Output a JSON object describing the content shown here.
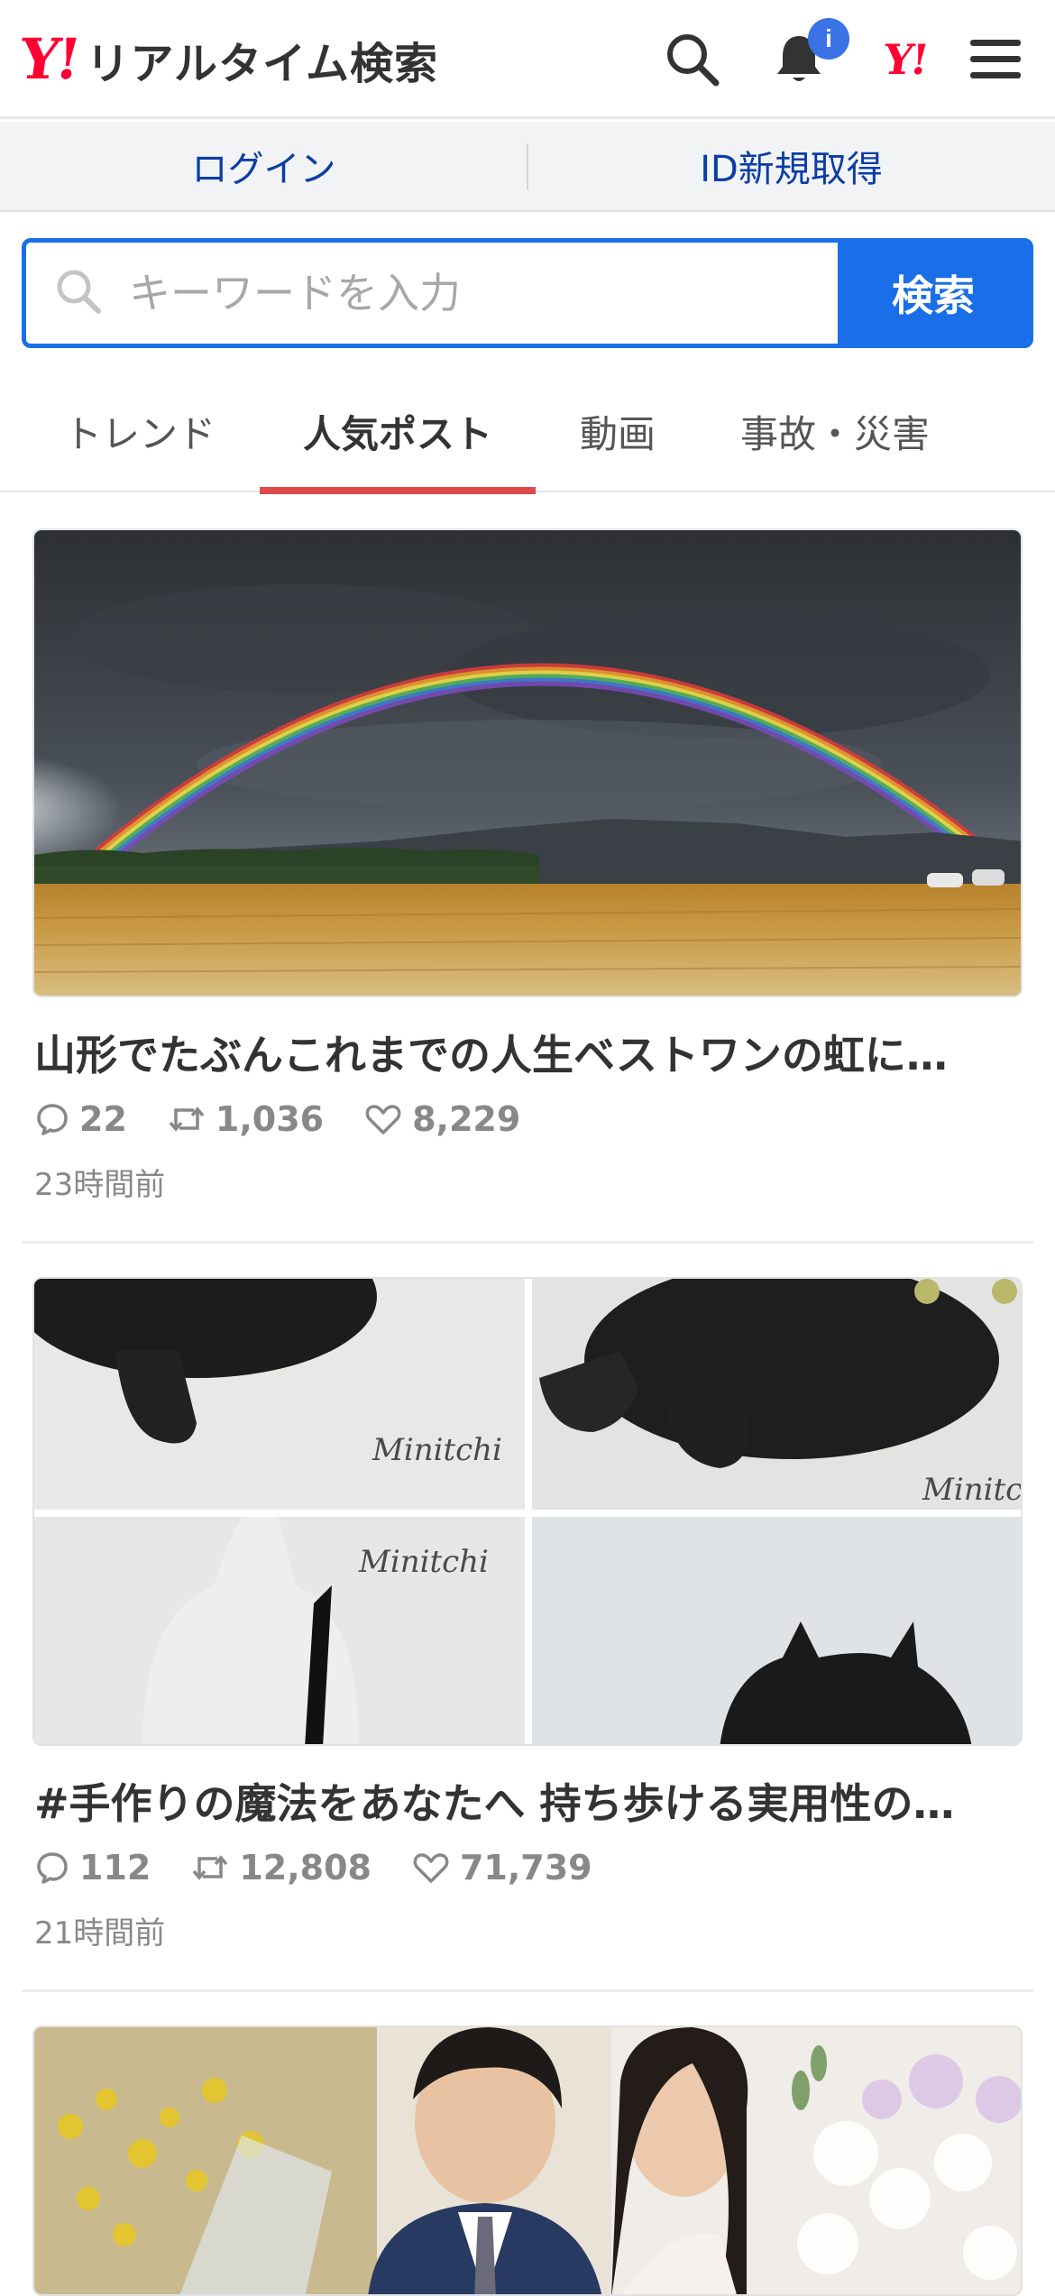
{
  "header": {
    "logo_mark": "Y!",
    "logo_text": "リアルタイム検索",
    "notification_badge": "i",
    "yj_mark": "Y!"
  },
  "loginbar": {
    "login_label": "ログイン",
    "register_label": "ID新規取得"
  },
  "search": {
    "placeholder": "キーワードを入力",
    "button_label": "検索"
  },
  "tabs": [
    {
      "label": "トレンド",
      "active": false
    },
    {
      "label": "人気ポスト",
      "active": true
    },
    {
      "label": "動画",
      "active": false
    },
    {
      "label": "事故・災害",
      "active": false
    }
  ],
  "posts": [
    {
      "title": "山形でたぶんこれまでの人生ベストワンの虹に…",
      "replies": "22",
      "reposts": "1,036",
      "likes": "8,229",
      "time": "23時間前"
    },
    {
      "title": "#手作りの魔法をあなたへ 持ち歩ける実用性の…",
      "replies": "112",
      "reposts": "12,808",
      "likes": "71,739",
      "time": "21時間前",
      "watermark": "Minitchi"
    },
    {
      "title": "",
      "replies": "",
      "reposts": "",
      "likes": "",
      "time": ""
    }
  ],
  "colors": {
    "brand_red": "#ff0033",
    "accent_blue": "#1a6fe8",
    "tab_indicator": "#e0494b",
    "link_blue": "#0a3ea6"
  }
}
